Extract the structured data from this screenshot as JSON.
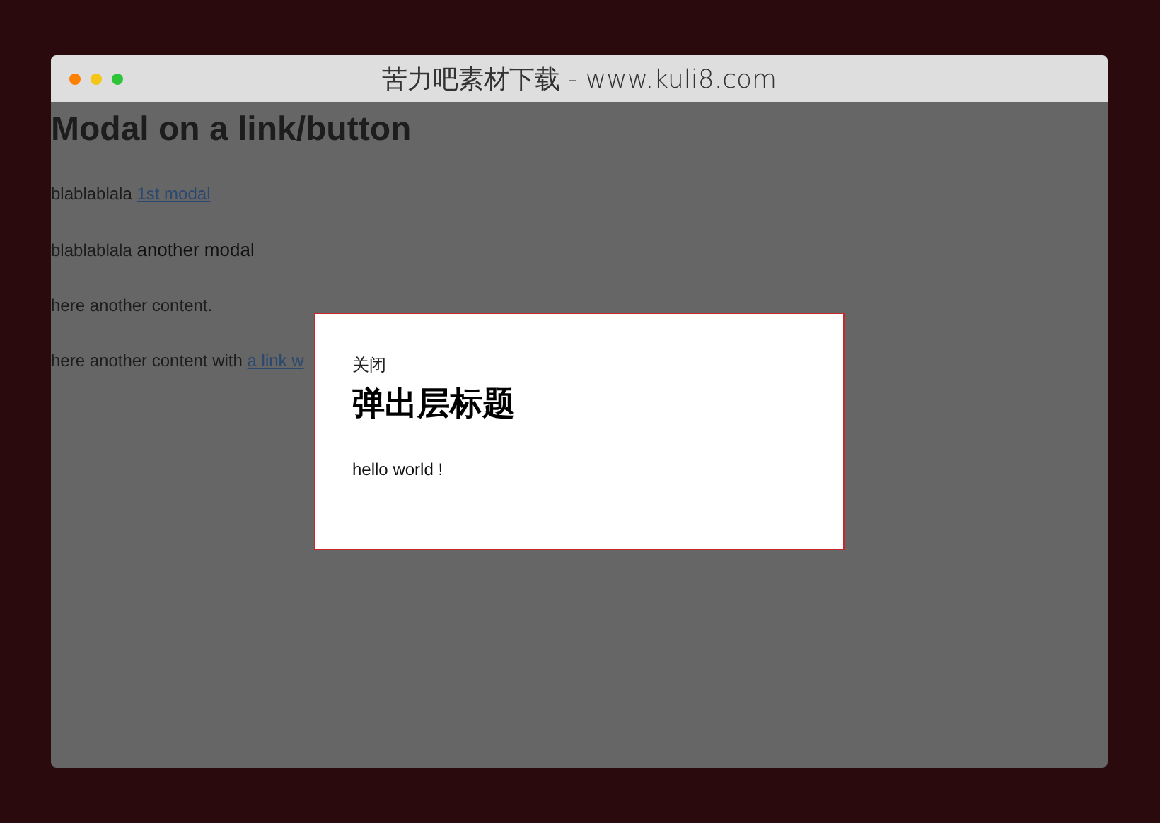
{
  "window": {
    "title": "苦力吧素材下载 - www.kuli8.com",
    "controls": [
      {
        "color": "#ff7f00"
      },
      {
        "color": "#f5c518"
      },
      {
        "color": "#2ec438"
      }
    ]
  },
  "page": {
    "heading": "Modal on a link/button",
    "paragraphs": [
      {
        "segments": [
          {
            "kind": "text",
            "text": "blablablala "
          },
          {
            "kind": "link",
            "text": "1st modal"
          }
        ]
      },
      {
        "segments": [
          {
            "kind": "text",
            "text": "blablablala "
          },
          {
            "kind": "button",
            "text": "another modal"
          }
        ]
      },
      {
        "segments": [
          {
            "kind": "text",
            "text": "here another content."
          }
        ]
      },
      {
        "segments": [
          {
            "kind": "text",
            "text": "here another content with "
          },
          {
            "kind": "link",
            "text": "a link w"
          }
        ]
      }
    ]
  },
  "modal": {
    "close": "关闭",
    "title": "弹出层标题",
    "body": "hello world !"
  }
}
